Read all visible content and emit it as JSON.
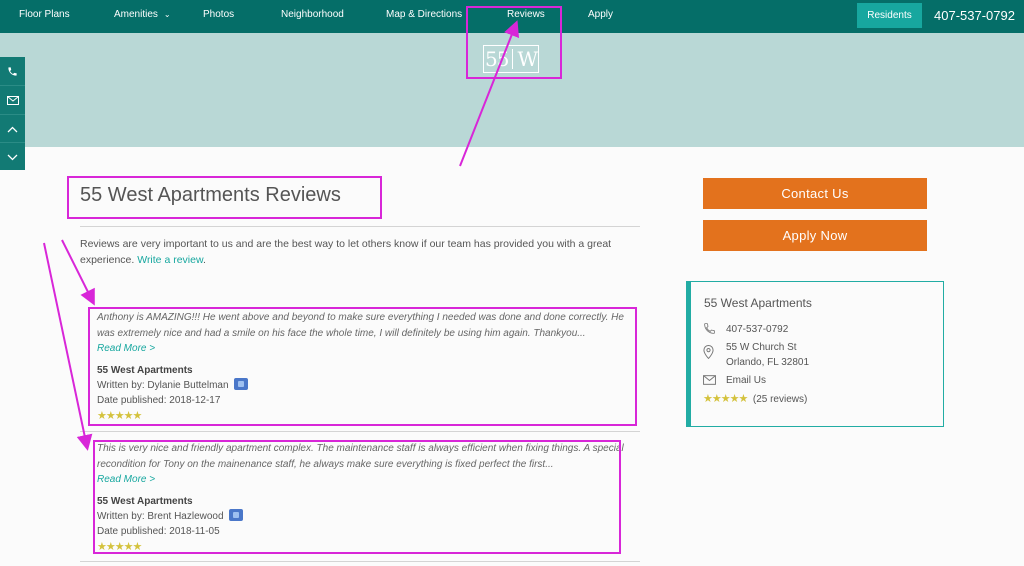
{
  "nav": {
    "items": [
      {
        "label": "Floor Plans",
        "has_dropdown": false
      },
      {
        "label": "Amenities",
        "has_dropdown": true
      },
      {
        "label": "Photos",
        "has_dropdown": false
      },
      {
        "label": "Neighborhood",
        "has_dropdown": false
      },
      {
        "label": "Map & Directions",
        "has_dropdown": false
      },
      {
        "label": "Reviews",
        "has_dropdown": false
      },
      {
        "label": "Apply",
        "has_dropdown": false
      }
    ],
    "dropdown_glyph": "⌄",
    "residents_label": "Residents",
    "phone": "407-537-0792"
  },
  "logo": {
    "left": "55",
    "right": "W"
  },
  "side_tabs": [
    {
      "icon": "phone-icon"
    },
    {
      "icon": "envelope-icon"
    },
    {
      "icon": "chevron-up-icon"
    },
    {
      "icon": "chevron-down-icon"
    }
  ],
  "page": {
    "title": "55 West Apartments Reviews",
    "intro_text": "Reviews are very important to us and are the best way to let others know if our team has provided you with a great experience.",
    "intro_link": "Write a review",
    "intro_end": "."
  },
  "reviews": [
    {
      "text": "Anthony is AMAZING!!! He went above and beyond to make sure everything I needed was done and done correctly. He was extremely nice and had a smile on his face the whole time, I will definitely be using him again. Thankyou...",
      "read_more": "Read More >",
      "property": "55 West Apartments",
      "written_by": "Written by: Dylanie Buttelman",
      "date": "Date published: 2018-12-17",
      "stars": "★★★★★",
      "source_icon": "google-review-icon"
    },
    {
      "text": "This is very nice and friendly apartment complex. The maintenance staff is always efficient when fixing things. A special recondition for Tony on the mainenance staff, he always make sure everything is fixed perfect the first...",
      "read_more": "Read More >",
      "property": "55 West Apartments",
      "written_by": "Written by: Brent Hazlewood",
      "date": "Date published: 2018-11-05",
      "stars": "★★★★★",
      "source_icon": "google-review-icon"
    }
  ],
  "sidebar": {
    "contact_label": "Contact Us",
    "apply_label": "Apply Now",
    "card": {
      "name": "55 West Apartments",
      "phone": "407-537-0792",
      "address_line1": "55 W Church St",
      "address_line2": "Orlando, FL 32801",
      "email_label": "Email Us",
      "stars": "★★★★★",
      "reviews_count": "(25 reviews)"
    }
  },
  "colors": {
    "nav_bg": "#056e68",
    "accent_teal": "#17a79f",
    "hero_bg": "#b9d8d6",
    "cta_orange": "#e3721d",
    "annotation_magenta": "#d826d8",
    "star_gold": "#d4c23c"
  }
}
